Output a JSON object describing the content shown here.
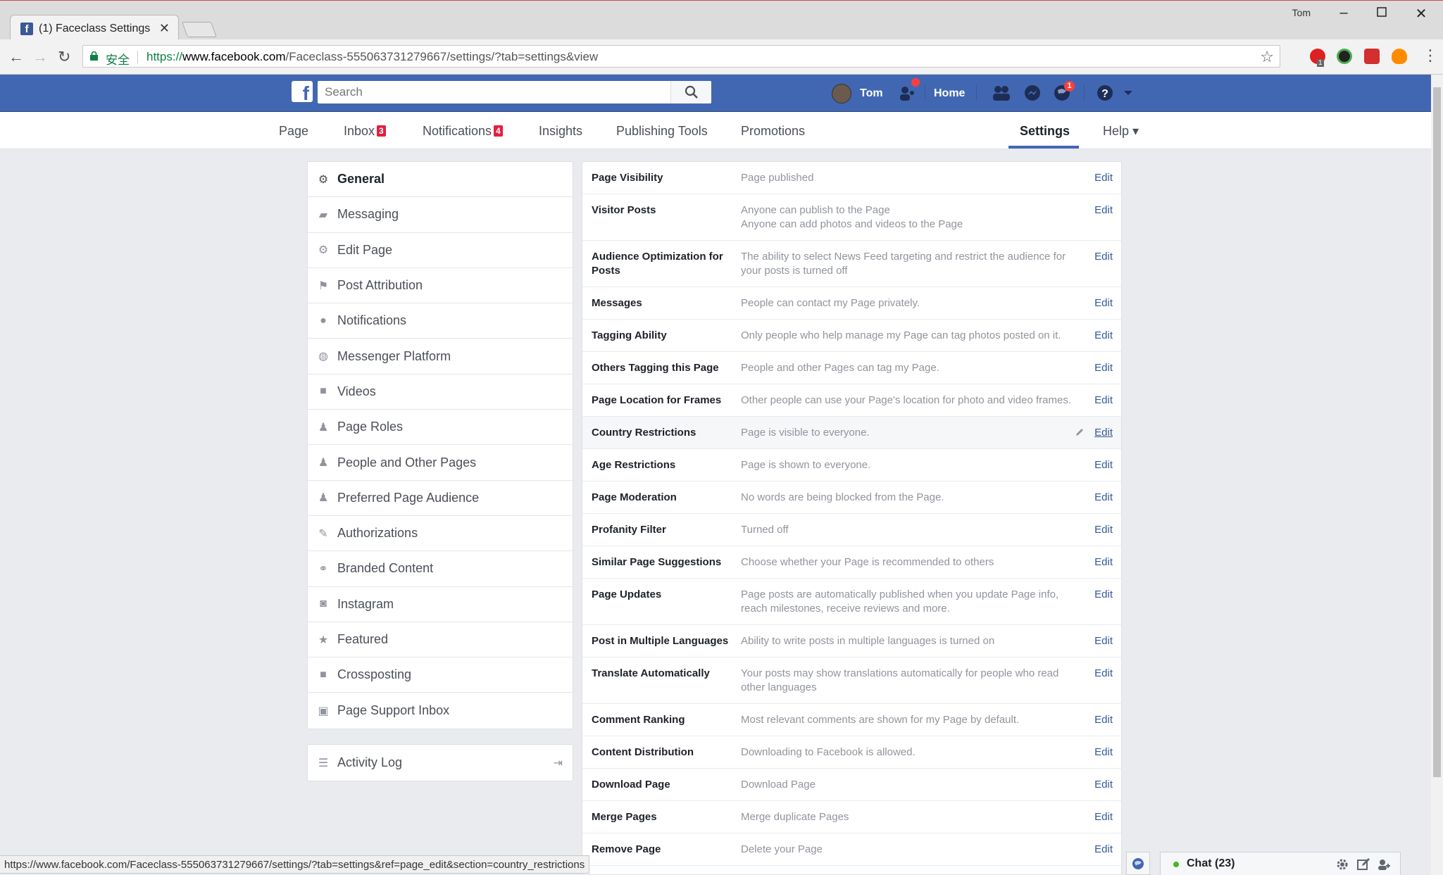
{
  "browser": {
    "tab_title": "(1) Faceclass Settings",
    "tab_favicon": "f",
    "window_user": "Tom",
    "secure_label": "安全",
    "url_scheme": "https://",
    "url_host": "www.facebook.com",
    "url_path": "/Faceclass-555063731279667/settings/?tab=settings&view",
    "status_url": "https://www.facebook.com/Faceclass-555063731279667/settings/?tab=settings&ref=page_edit&section=country_restrictions",
    "extension_badge": "1"
  },
  "fb_topbar": {
    "logo": "f",
    "search_placeholder": "Search",
    "user_name": "Tom",
    "home_label": "Home",
    "notifications_badge": "1",
    "brand_color": "#4267b2"
  },
  "page_nav": {
    "tabs": [
      {
        "label": "Page"
      },
      {
        "label": "Inbox",
        "count": "3"
      },
      {
        "label": "Notifications",
        "count": "4"
      },
      {
        "label": "Insights"
      },
      {
        "label": "Publishing Tools"
      },
      {
        "label": "Promotions"
      },
      {
        "label": "Settings"
      },
      {
        "label": "Help ▾"
      }
    ]
  },
  "left_nav": {
    "items": [
      {
        "label": "General",
        "icon": "gear-icon"
      },
      {
        "label": "Messaging",
        "icon": "chat-icon"
      },
      {
        "label": "Edit Page",
        "icon": "gear-icon"
      },
      {
        "label": "Post Attribution",
        "icon": "flag-icon"
      },
      {
        "label": "Notifications",
        "icon": "globe-icon"
      },
      {
        "label": "Messenger Platform",
        "icon": "messenger-icon"
      },
      {
        "label": "Videos",
        "icon": "video-icon"
      },
      {
        "label": "Page Roles",
        "icon": "person-icon"
      },
      {
        "label": "People and Other Pages",
        "icon": "person-add-icon"
      },
      {
        "label": "Preferred Page Audience",
        "icon": "person-add-icon"
      },
      {
        "label": "Authorizations",
        "icon": "wrench-icon"
      },
      {
        "label": "Branded Content",
        "icon": "handshake-icon"
      },
      {
        "label": "Instagram",
        "icon": "instagram-icon"
      },
      {
        "label": "Featured",
        "icon": "star-icon"
      },
      {
        "label": "Crossposting",
        "icon": "video-icon"
      },
      {
        "label": "Page Support Inbox",
        "icon": "facebook-icon"
      }
    ],
    "activity_log": "Activity Log"
  },
  "settings": {
    "edit_label": "Edit",
    "rows": [
      {
        "label": "Page Visibility",
        "desc": "Page published"
      },
      {
        "label": "Visitor Posts",
        "desc": "Anyone can publish to the Page\nAnyone can add photos and videos to the Page"
      },
      {
        "label": "Audience Optimization for Posts",
        "desc": "The ability to select News Feed targeting and restrict the audience for your posts is turned off"
      },
      {
        "label": "Messages",
        "desc": "People can contact my Page privately."
      },
      {
        "label": "Tagging Ability",
        "desc": "Only people who help manage my Page can tag photos posted on it."
      },
      {
        "label": "Others Tagging this Page",
        "desc": "People and other Pages can tag my Page."
      },
      {
        "label": "Page Location for Frames",
        "desc": "Other people can use your Page's location for photo and video frames."
      },
      {
        "label": "Country Restrictions",
        "desc": "Page is visible to everyone."
      },
      {
        "label": "Age Restrictions",
        "desc": "Page is shown to everyone."
      },
      {
        "label": "Page Moderation",
        "desc": "No words are being blocked from the Page."
      },
      {
        "label": "Profanity Filter",
        "desc": "Turned off"
      },
      {
        "label": "Similar Page Suggestions",
        "desc": "Choose whether your Page is recommended to others"
      },
      {
        "label": "Page Updates",
        "desc": "Page posts are automatically published when you update Page info, reach milestones, receive reviews and more."
      },
      {
        "label": "Post in Multiple Languages",
        "desc": "Ability to write posts in multiple languages is turned on"
      },
      {
        "label": "Translate Automatically",
        "desc": "Your posts may show translations automatically for people who read other languages"
      },
      {
        "label": "Comment Ranking",
        "desc": "Most relevant comments are shown for my Page by default."
      },
      {
        "label": "Content Distribution",
        "desc": "Downloading to Facebook is allowed."
      },
      {
        "label": "Download Page",
        "desc": "Download Page"
      },
      {
        "label": "Merge Pages",
        "desc": "Merge duplicate Pages"
      },
      {
        "label": "Remove Page",
        "desc": "Delete your Page"
      }
    ]
  },
  "chat": {
    "label": "Chat (23)"
  }
}
